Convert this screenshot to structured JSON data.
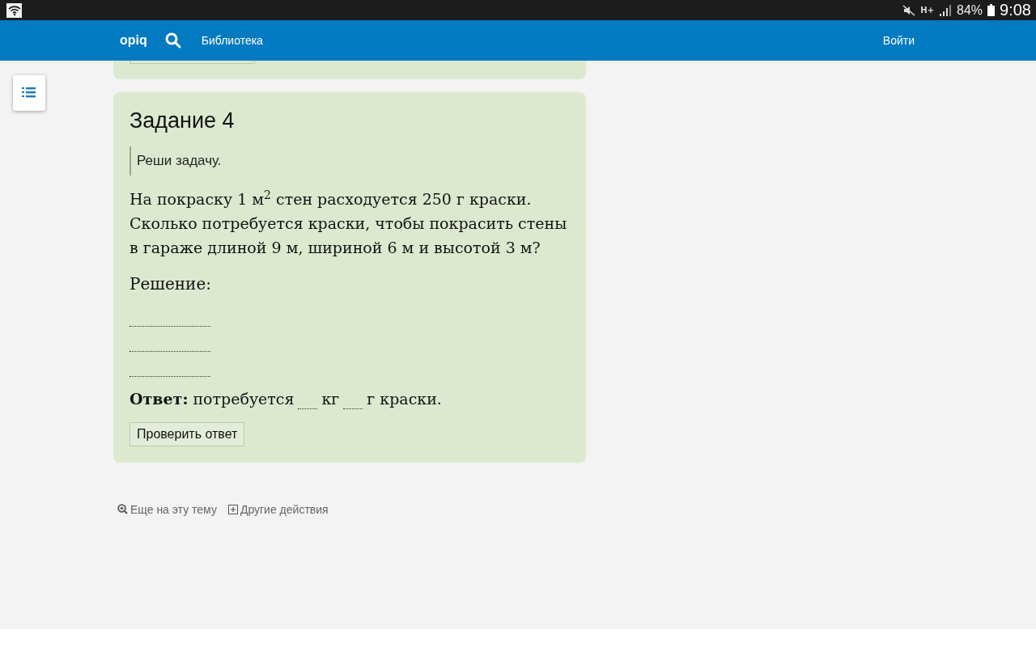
{
  "status_bar": {
    "network_type": "H+",
    "battery": "84%",
    "time": "9:08"
  },
  "nav": {
    "logo": "opiq",
    "links": [
      {
        "label": "Библиотека"
      }
    ],
    "login": "Войти"
  },
  "task": {
    "title": "Задание 4",
    "instruction": "Реши задачу.",
    "problem": "На покраску 1 м$^{2}$ стен расходуется 250 г краски. Сколько потребуется краски, чтобы покрасить стены в гараже длиной 9 м, шириной 6 м и высотой 3 м?",
    "solution_label": "Решение:",
    "solution_fields": [
      {
        "kind": "line"
      },
      {
        "kind": "line"
      },
      {
        "kind": "line"
      }
    ],
    "answer": [
      {
        "kind": "text",
        "text": "**Ответ:** потребуется"
      },
      {
        "kind": "blank"
      },
      {
        "kind": "text",
        "text": "кг"
      },
      {
        "kind": "blank"
      },
      {
        "kind": "text",
        "text": "г краски."
      }
    ],
    "check_button": "Проверить ответ"
  },
  "footer_links": [
    {
      "kind": "more",
      "label": "Еще на эту тему"
    },
    {
      "kind": "actions",
      "label": "Другие действия"
    }
  ]
}
